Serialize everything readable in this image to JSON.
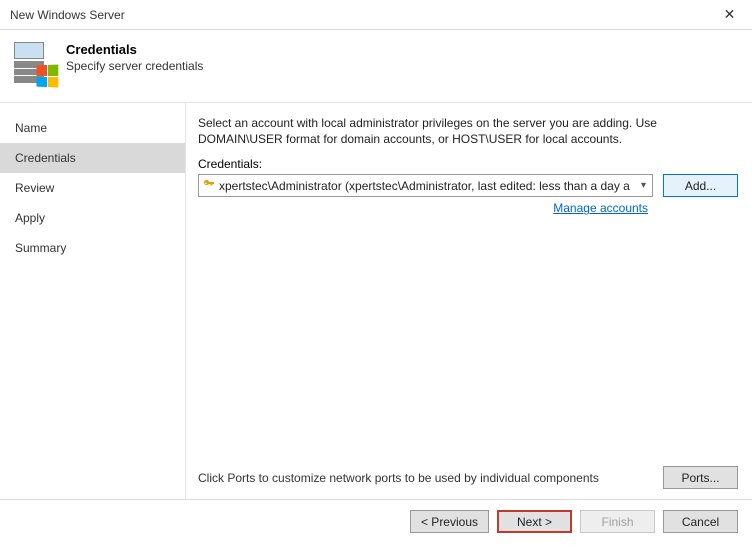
{
  "window": {
    "title": "New Windows Server",
    "close": "✕"
  },
  "header": {
    "title": "Credentials",
    "subtitle": "Specify server credentials"
  },
  "sidebar": {
    "items": [
      {
        "label": "Name",
        "selected": false
      },
      {
        "label": "Credentials",
        "selected": true
      },
      {
        "label": "Review",
        "selected": false
      },
      {
        "label": "Apply",
        "selected": false
      },
      {
        "label": "Summary",
        "selected": false
      }
    ]
  },
  "main": {
    "instruction": "Select an account with local administrator privileges on the server you are adding. Use DOMAIN\\USER format for domain accounts, or HOST\\USER for local accounts.",
    "credentials_label": "Credentials:",
    "selected_credential": "xpertstec\\Administrator (xpertstec\\Administrator, last edited: less than a day a",
    "add_button": "Add...",
    "manage_link": "Manage accounts",
    "ports_text": "Click Ports to customize network ports to be used by individual components",
    "ports_button": "Ports..."
  },
  "footer": {
    "previous": "< Previous",
    "next": "Next >",
    "finish": "Finish",
    "cancel": "Cancel"
  }
}
